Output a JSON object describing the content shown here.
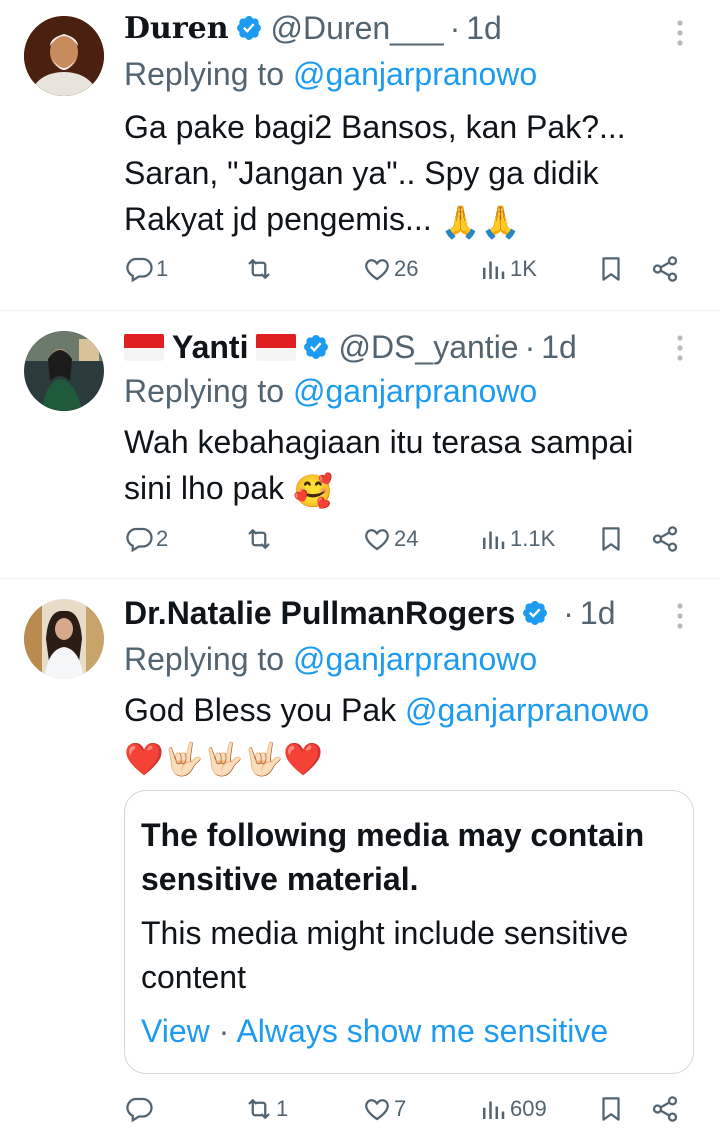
{
  "tweets": [
    {
      "name": "Duren",
      "handle": "@Duren___",
      "time": "1d",
      "replying_prefix": "Replying to",
      "replying_to": "@ganjarpranowo",
      "text_lines": [
        "Ga pake bagi2 Bansos, kan Pak?...",
        "Saran, \"Jangan ya\".. Spy ga didik",
        "Rakyat jd pengemis..."
      ],
      "text_emoji": "🙏🙏",
      "replies": "1",
      "retweets": "",
      "likes": "26",
      "views": "1K"
    },
    {
      "name": "Yanti",
      "handle": "@DS_yantie",
      "time": "1d",
      "replying_prefix": "Replying to",
      "replying_to": "@ganjarpranowo",
      "text_lines": [
        "Wah kebahagiaan itu terasa sampai",
        "sini lho pak"
      ],
      "text_emoji": "🥰",
      "replies": "2",
      "retweets": "",
      "likes": "24",
      "views": "1.1K"
    },
    {
      "name": "Dr.Natalie PullmanRogers",
      "handle": "",
      "time": "1d",
      "replying_prefix": "Replying to",
      "replying_to": "@ganjarpranowo",
      "text_prefix": "God Bless you Pak",
      "text_mention": "@ganjarpranowo",
      "text_emoji": "❤️🤟🏻🤟🏻🤟🏻❤️",
      "sensitive": {
        "title": "The following media may contain sensitive material.",
        "description": "This media might include sensitive content",
        "view_link": "View",
        "separator": "·",
        "always_show_link": "Always show me sensitive"
      },
      "replies": "",
      "retweets": "1",
      "likes": "7",
      "views": "609"
    }
  ],
  "colors": {
    "text": "#0f1419",
    "secondary": "#536471",
    "link": "#1d9bf0",
    "divider": "#eff3f4",
    "verified": "#1d9bf0"
  },
  "icons": {
    "reply": "reply-icon",
    "retweet": "retweet-icon",
    "like": "heart-icon",
    "views": "views-icon",
    "bookmark": "bookmark-icon",
    "share": "share-icon",
    "more": "more-icon",
    "verified": "verified-badge-icon"
  }
}
